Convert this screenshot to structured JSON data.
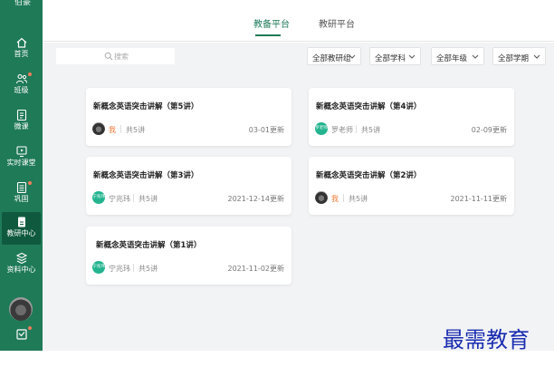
{
  "app": {
    "name": "伯豪"
  },
  "sidebar": {
    "items": [
      {
        "label": "首页",
        "icon": "home-icon"
      },
      {
        "label": "班级",
        "icon": "class-icon"
      },
      {
        "label": "微课",
        "icon": "micro-lesson-icon"
      },
      {
        "label": "实时课堂",
        "icon": "live-class-icon"
      },
      {
        "label": "巩固",
        "icon": "consolidate-icon"
      },
      {
        "label": "教研中心",
        "icon": "research-center-icon",
        "active": true
      },
      {
        "label": "资料中心",
        "icon": "resource-center-icon"
      }
    ],
    "bottom_icon": "message-icon"
  },
  "tabs": [
    {
      "label": "教备平台",
      "active": true
    },
    {
      "label": "教研平台",
      "active": false
    }
  ],
  "search": {
    "placeholder": "搜索"
  },
  "filters": [
    {
      "value": "全部教研组"
    },
    {
      "value": "全部学科"
    },
    {
      "value": "全部年级"
    },
    {
      "value": "全部学期"
    }
  ],
  "cards": [
    {
      "title": "新概念英语突击讲解（第5讲）",
      "avatar_text": "",
      "author": "我",
      "count": "共5讲",
      "updated": "03-01更新"
    },
    {
      "title": "新概念英语突击讲解（第4讲）",
      "avatar_text": "罗老师",
      "author": "罗老师",
      "count": "共5讲",
      "updated": "02-09更新"
    },
    {
      "title": "新概念英语突击讲解（第3讲）",
      "avatar_text": "宁兆玮",
      "author": "宁兆玮",
      "count": "共5讲",
      "updated": "2021-12-14更新"
    },
    {
      "title": "新概念英语突击讲解（第2讲）",
      "avatar_text": "",
      "author": "我",
      "count": "共5讲",
      "updated": "2021-11-11更新"
    },
    {
      "title": "新概念英语突击讲解（第1讲）",
      "avatar_text": "宁兆玮",
      "author": "宁兆玮",
      "count": "共5讲",
      "updated": "2021-11-02更新"
    }
  ],
  "watermark": "最需教育",
  "colors": {
    "brand": "#1f7a58",
    "brand_dark": "#0f5a3e",
    "avatar_green": "#23b48f",
    "accent_orange": "#f07c3c",
    "watermark": "#1a2db0"
  }
}
